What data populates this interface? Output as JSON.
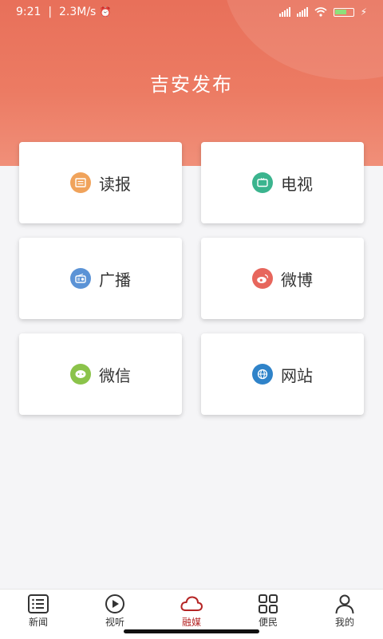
{
  "status_bar": {
    "time": "9:21",
    "speed": "2.3M/s"
  },
  "header": {
    "title": "吉安发布"
  },
  "cards": [
    {
      "label": "读报",
      "icon": "newspaper-icon",
      "color": "#f0a35b"
    },
    {
      "label": "电视",
      "icon": "tv-icon",
      "color": "#3bb48e"
    },
    {
      "label": "广播",
      "icon": "radio-icon",
      "color": "#5b93d6"
    },
    {
      "label": "微博",
      "icon": "weibo-icon",
      "color": "#e7665c"
    },
    {
      "label": "微信",
      "icon": "wechat-icon",
      "color": "#8bc34a"
    },
    {
      "label": "网站",
      "icon": "globe-icon",
      "color": "#2f83c9"
    }
  ],
  "tabbar": [
    {
      "label": "新闻",
      "icon": "list-icon"
    },
    {
      "label": "视听",
      "icon": "play-icon"
    },
    {
      "label": "融媒",
      "icon": "cloud-icon",
      "active": true
    },
    {
      "label": "便民",
      "icon": "grid-icon"
    },
    {
      "label": "我的",
      "icon": "user-icon"
    }
  ],
  "colors": {
    "header": "#e8705a",
    "active_tab": "#b52525"
  }
}
